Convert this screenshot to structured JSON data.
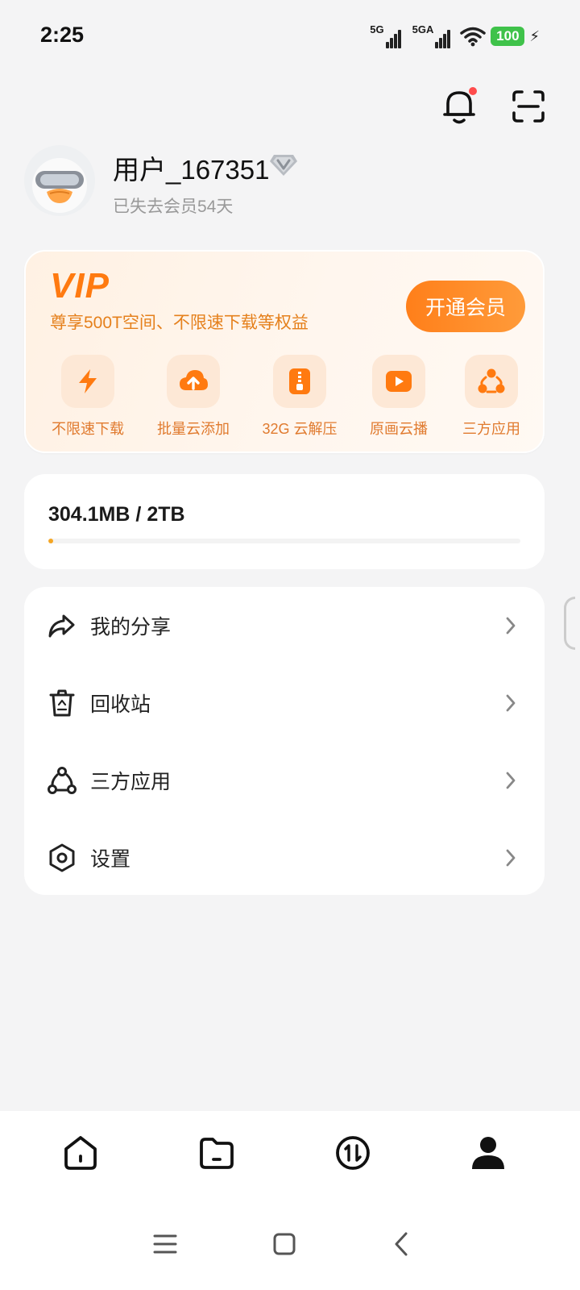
{
  "status_bar": {
    "time": "2:25",
    "signal_1_label": "5G",
    "signal_2_label": "5GA",
    "battery_level": "100",
    "battery_color": "#3fc24a"
  },
  "header": {
    "icons": [
      "bell-icon",
      "scan-icon"
    ],
    "notification_dot_color": "#ff4c4c"
  },
  "profile": {
    "username": "用户_167351",
    "member_status": "已失去会员54天"
  },
  "vip": {
    "title": "VIP",
    "subtitle": "尊享500T空间、不限速下载等权益",
    "button_label": "开通会员",
    "accent_color": "#ff7a10",
    "perks": [
      {
        "label": "不限速下载",
        "icon": "lightning-icon"
      },
      {
        "label": "批量云添加",
        "icon": "cloud-upload-icon"
      },
      {
        "label": "32G 云解压",
        "icon": "zip-file-icon"
      },
      {
        "label": "原画云播",
        "icon": "video-play-icon"
      },
      {
        "label": "三方应用",
        "icon": "third-party-apps-icon"
      }
    ]
  },
  "storage": {
    "used": "304.1MB",
    "separator": "/",
    "total": "2TB",
    "used_fraction": 0.00015
  },
  "menu": {
    "items": [
      {
        "label": "我的分享",
        "icon": "share-icon"
      },
      {
        "label": "回收站",
        "icon": "recycle-bin-icon"
      },
      {
        "label": "三方应用",
        "icon": "third-party-apps-icon"
      },
      {
        "label": "设置",
        "icon": "settings-icon"
      }
    ]
  },
  "bottom_nav": {
    "items": [
      "home-icon",
      "folder-icon",
      "transfer-icon",
      "profile-icon"
    ],
    "active": "profile-icon"
  },
  "system_nav": [
    "menu-icon",
    "home-square-icon",
    "back-icon"
  ]
}
